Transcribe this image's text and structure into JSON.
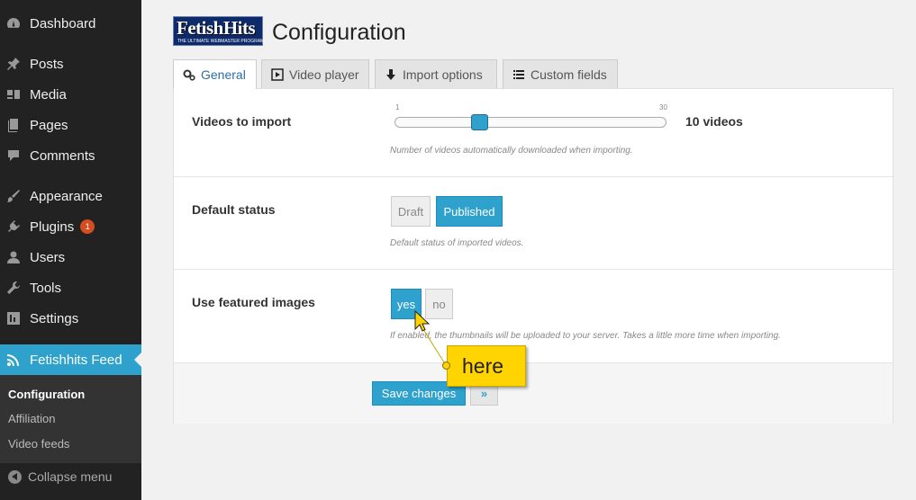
{
  "sidebar": {
    "items": [
      {
        "label": "Dashboard",
        "icon": "dashboard-icon"
      },
      {
        "label": "Posts",
        "icon": "pin-icon"
      },
      {
        "label": "Media",
        "icon": "media-icon"
      },
      {
        "label": "Pages",
        "icon": "pages-icon"
      },
      {
        "label": "Comments",
        "icon": "comment-icon"
      },
      {
        "label": "Appearance",
        "icon": "paintbrush-icon"
      },
      {
        "label": "Plugins",
        "icon": "plugin-icon",
        "badge": "1"
      },
      {
        "label": "Users",
        "icon": "user-icon"
      },
      {
        "label": "Tools",
        "icon": "wrench-icon"
      },
      {
        "label": "Settings",
        "icon": "settings-icon"
      },
      {
        "label": "Fetishhits Feed",
        "icon": "rss-icon"
      }
    ],
    "submenu": [
      "Configuration",
      "Affiliation",
      "Video feeds"
    ],
    "collapse_label": "Collapse menu"
  },
  "logo": {
    "main": "FetishHits",
    "sub": "THE ULTIMATE WEBMASTER PROGRAM"
  },
  "page": {
    "title": "Configuration"
  },
  "tabs": [
    {
      "label": "General",
      "icon": "gears-icon"
    },
    {
      "label": "Video player",
      "icon": "play-icon"
    },
    {
      "label": "Import options",
      "icon": "download-arrow-icon"
    },
    {
      "label": "Custom fields",
      "icon": "list-icon"
    }
  ],
  "settings": {
    "videos": {
      "label": "Videos to import",
      "min": "1",
      "max": "30",
      "value": 10,
      "value_text": "10 videos",
      "desc": "Number of videos automatically downloaded when importing."
    },
    "status": {
      "label": "Default status",
      "options": [
        "Draft",
        "Published"
      ],
      "selected": "Published",
      "desc": "Default status of imported videos."
    },
    "featured": {
      "label": "Use featured images",
      "options": [
        "yes",
        "no"
      ],
      "selected": "yes",
      "desc": "If enabled, the thumbnails will be uploaded to your server. Takes a little more time when importing."
    }
  },
  "buttons": {
    "save": "Save changes",
    "more": "»"
  },
  "annotation": {
    "text": "here"
  },
  "colors": {
    "accent": "#2ea2cc",
    "sidebar_bg": "#222222",
    "callout": "#ffd400",
    "badge": "#d54e21"
  }
}
